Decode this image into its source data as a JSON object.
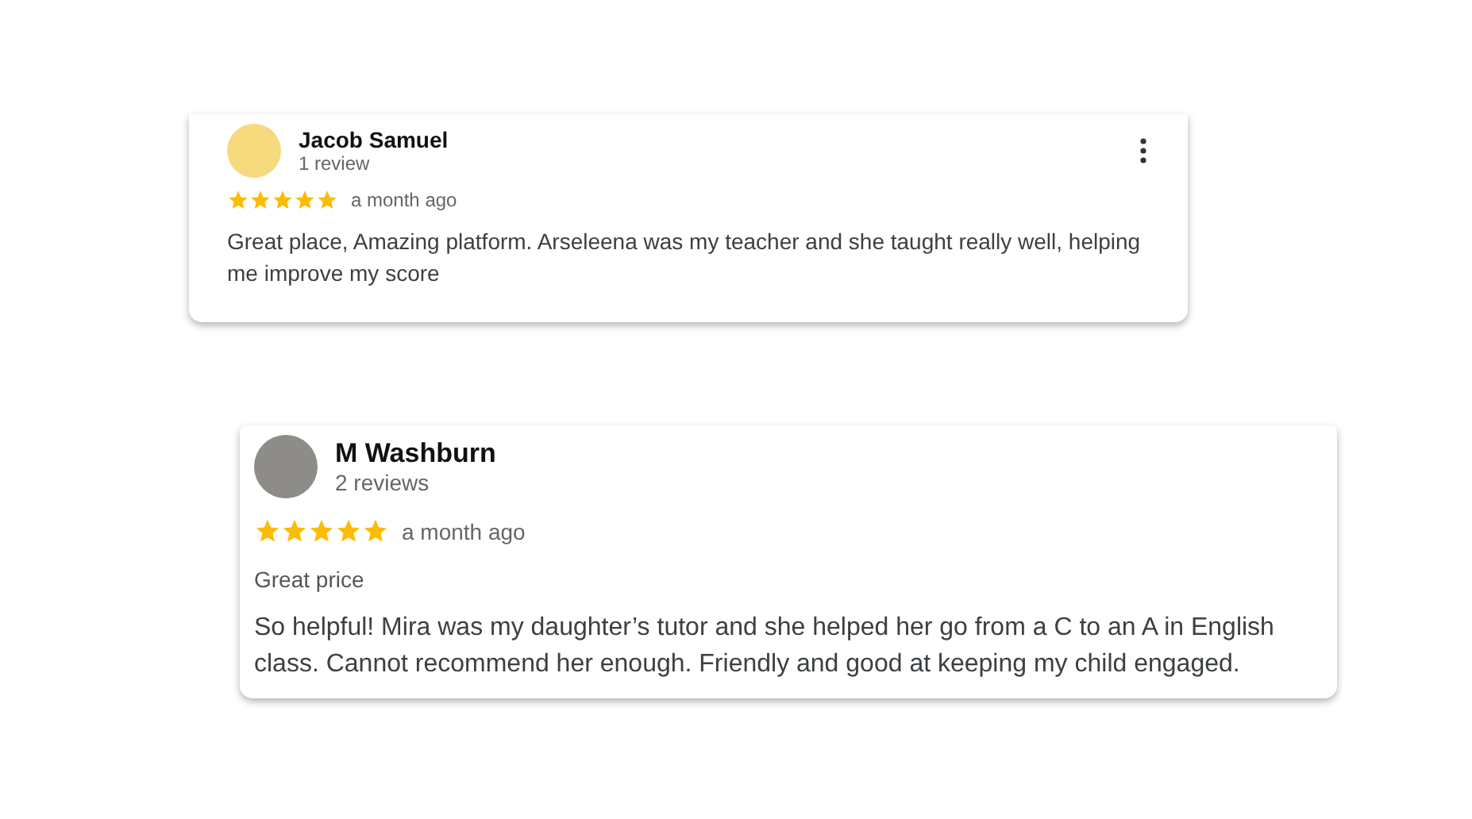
{
  "reviews": [
    {
      "name": "Jacob Samuel",
      "count": "1 review",
      "stars": 5,
      "time": "a month ago",
      "menu": true,
      "kind": "compact",
      "text": "Great place, Amazing platform. Arseleena was my teacher and she taught really well, helping me improve my score"
    },
    {
      "name": "M Washburn",
      "count": "2 reviews",
      "stars": 5,
      "time": "a month ago",
      "menu": false,
      "kind": "spacious",
      "tag": "Great price",
      "text": "So helpful! Mira was my daughter’s tutor and she helped her go from a C to an A in English class. Cannot recommend her enough. Friendly and good at keeping my child engaged."
    }
  ]
}
